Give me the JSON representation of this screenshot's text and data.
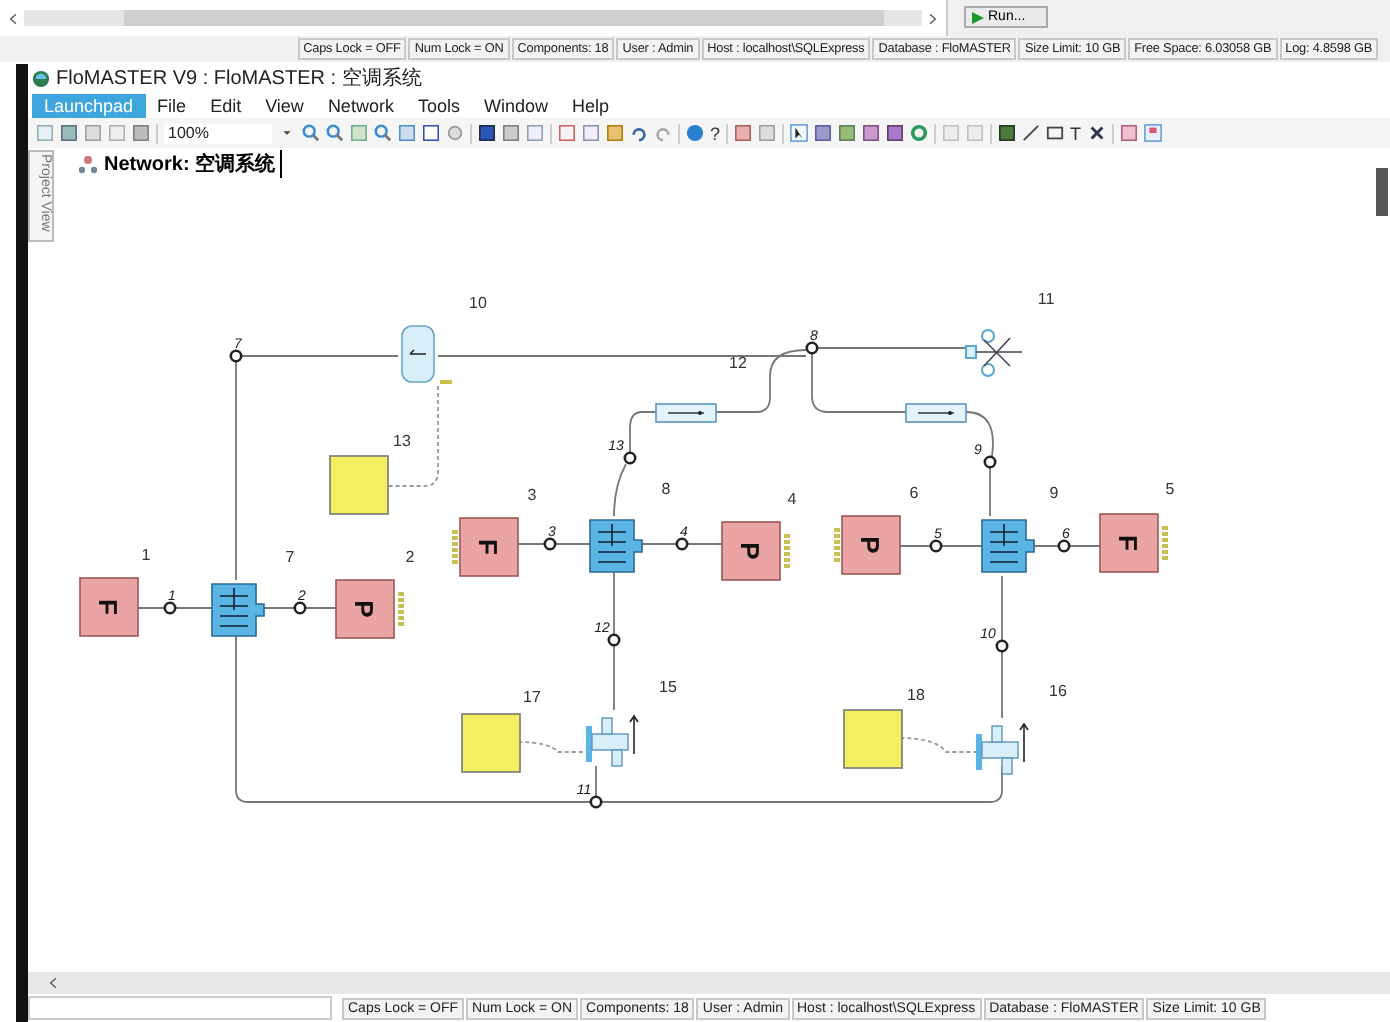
{
  "background_window": {
    "run_button": "Run...",
    "status_bar": [
      "Caps Lock = OFF",
      "Num Lock = ON",
      "Components: 18",
      "User : Admin",
      "Host : localhost\\SQLExpress",
      "Database : FloMASTER",
      "Size Limit: 10 GB",
      "Free Space: 6.03058 GB",
      "Log: 4.8598 GB"
    ]
  },
  "window": {
    "title": "FloMASTER V9 : FloMASTER : 空调系统"
  },
  "menu": [
    {
      "label": "Launchpad",
      "selected": true
    },
    {
      "label": "File",
      "selected": false
    },
    {
      "label": "Edit",
      "selected": false
    },
    {
      "label": "View",
      "selected": false
    },
    {
      "label": "Network",
      "selected": false
    },
    {
      "label": "Tools",
      "selected": false
    },
    {
      "label": "Window",
      "selected": false
    },
    {
      "label": "Help",
      "selected": false
    }
  ],
  "toolbar": {
    "zoom": "100%",
    "help_glyph": "?",
    "text_tool_glyph": "T"
  },
  "side_tab": "Project View",
  "document_tab": "Network: 空调系统",
  "components": [
    {
      "label": "1",
      "kind": "flow_source",
      "symbol": "F"
    },
    {
      "label": "2",
      "kind": "pressure_source",
      "symbol": "P"
    },
    {
      "label": "3",
      "kind": "flow_source",
      "symbol": "F"
    },
    {
      "label": "4",
      "kind": "pressure_source",
      "symbol": "P"
    },
    {
      "label": "6",
      "kind": "pressure_source",
      "symbol": "P"
    },
    {
      "label": "5",
      "kind": "flow_source",
      "symbol": "F"
    },
    {
      "label": "7",
      "kind": "heat_exchanger"
    },
    {
      "label": "8",
      "kind": "heat_exchanger"
    },
    {
      "label": "9",
      "kind": "heat_exchanger"
    },
    {
      "label": "10",
      "kind": "receiver"
    },
    {
      "label": "11",
      "kind": "splitter"
    },
    {
      "label": "12",
      "kind": "pipe"
    },
    {
      "kind": "pipe"
    },
    {
      "label": "13",
      "kind": "controller"
    },
    {
      "label": "15",
      "kind": "valve"
    },
    {
      "label": "16",
      "kind": "valve"
    },
    {
      "label": "17",
      "kind": "controller"
    },
    {
      "label": "18",
      "kind": "controller"
    }
  ],
  "nodes": [
    "1",
    "2",
    "3",
    "4",
    "5",
    "6",
    "7",
    "8",
    "9",
    "10",
    "11",
    "12",
    "13"
  ],
  "status_bar": [
    "Caps Lock = OFF",
    "Num Lock = ON",
    "Components: 18",
    "User : Admin",
    "Host : localhost\\SQLExpress",
    "Database : FloMASTER",
    "Size Limit: 10 GB"
  ]
}
